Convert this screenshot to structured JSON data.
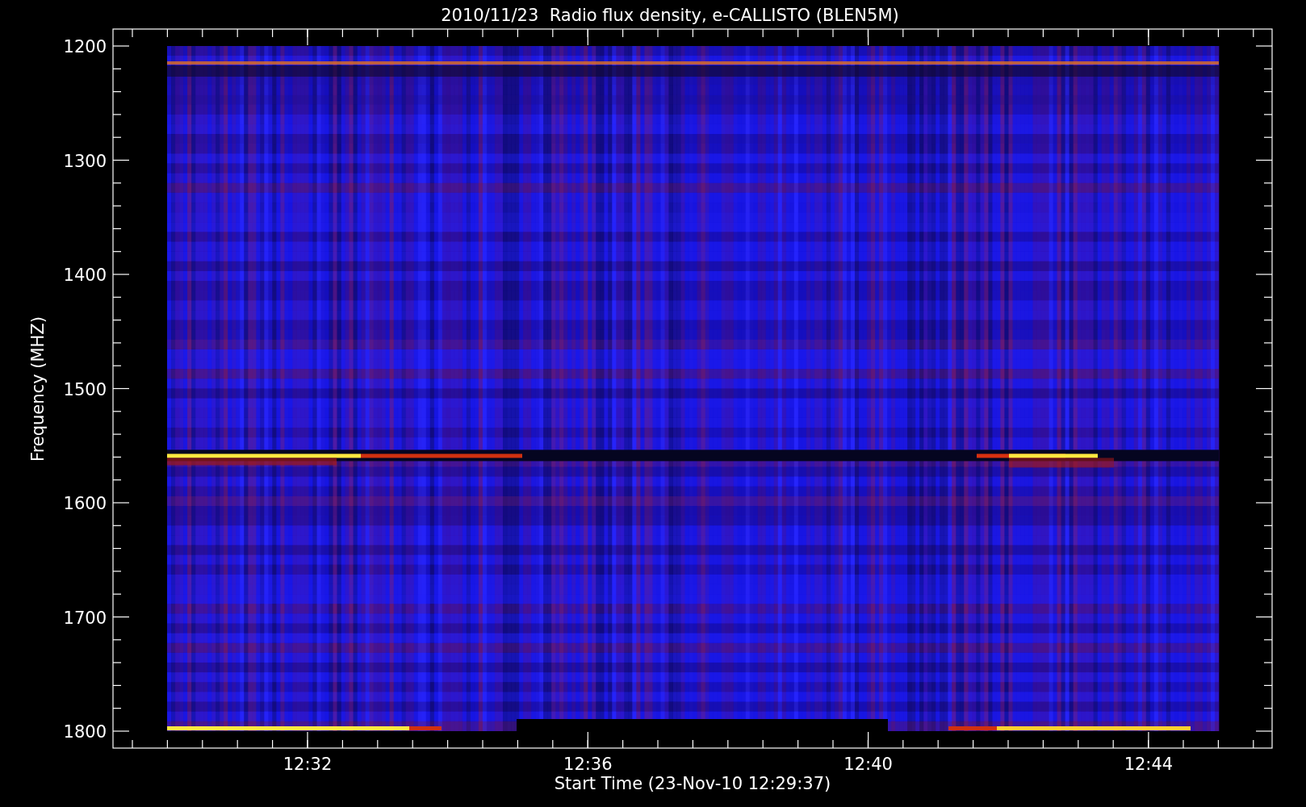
{
  "title": "2010/11/23  Radio flux density, e-CALLISTO (BLEN5M)",
  "ylabel": "Frequency (MHZ)",
  "xlabel": "Start Time (23-Nov-10 12:29:37)",
  "yticks": [
    "1200",
    "1300",
    "1400",
    "1500",
    "1600",
    "1700",
    "1800"
  ],
  "xticks": [
    "12:32",
    "12:36",
    "12:40",
    "12:44"
  ]
}
